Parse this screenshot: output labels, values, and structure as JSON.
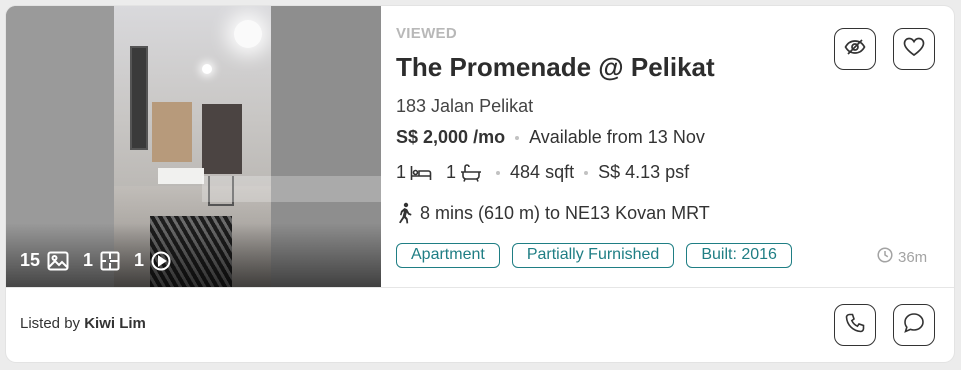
{
  "media": {
    "photo_count": "15",
    "floorplan_count": "1",
    "video_count": "1",
    "icons": [
      "image-icon",
      "floorplan-icon",
      "play-circle-icon"
    ]
  },
  "listing": {
    "status": "VIEWED",
    "title": "The Promenade @ Pelikat",
    "address": "183 Jalan Pelikat",
    "price": "S$ 2,000 /mo",
    "availability": "Available from 13 Nov",
    "bedrooms": "1",
    "bathrooms": "1",
    "size": "484 sqft",
    "psf": "S$ 4.13 psf",
    "mrt": "8 mins (610 m) to NE13 Kovan MRT",
    "tags": [
      "Apartment",
      "Partially Furnished",
      "Built: 2016"
    ],
    "posted_ago": "36m"
  },
  "footer": {
    "listed_by_prefix": "Listed by",
    "agent_name": "Kiwi Lim"
  },
  "actions": {
    "hide": "eye-slash-icon",
    "save": "heart-icon",
    "call": "phone-icon",
    "chat": "chat-icon"
  },
  "colors": {
    "accent": "#1f7e84",
    "muted": "#b8b8b8",
    "text": "#2d2d2d"
  }
}
